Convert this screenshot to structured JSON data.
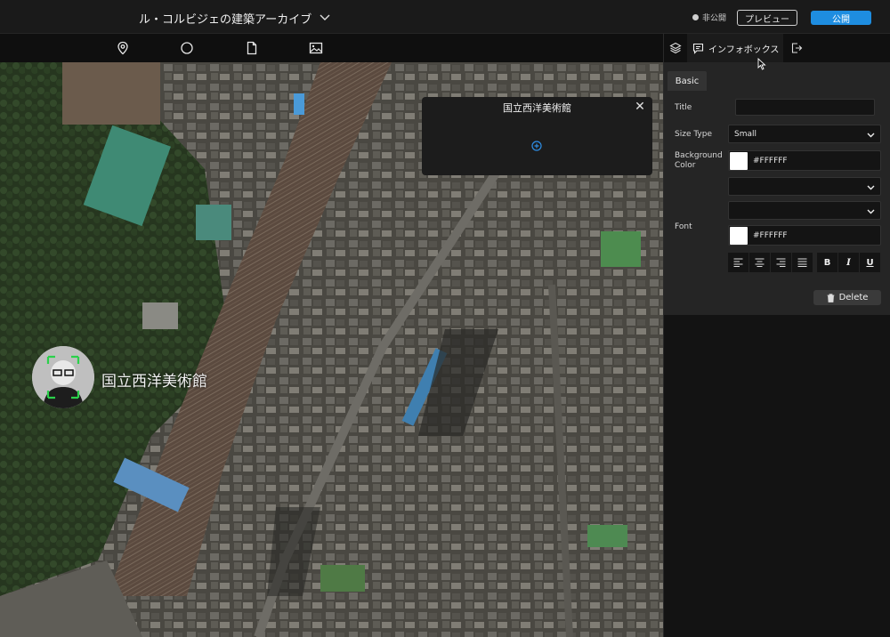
{
  "header": {
    "project_title": "ル・コルビジェの建築アーカイブ",
    "status_label": "非公開",
    "preview_label": "プレビュー",
    "publish_label": "公開",
    "accent_color": "#1e8de0"
  },
  "toolbar": {
    "tools": [
      "map-pin-icon",
      "circle-icon",
      "document-icon",
      "image-icon"
    ]
  },
  "map": {
    "popup": {
      "title": "国立西洋美術館",
      "close_symbol": "✕"
    },
    "marker": {
      "label": "国立西洋美術館"
    }
  },
  "panel": {
    "tabs": {
      "layers_icon": "layers-icon",
      "active_label": "インフォボックス",
      "exit_icon": "exit-icon"
    },
    "basic_tab": "Basic",
    "title_label": "Title",
    "title_value": "",
    "size_type_label": "Size Type",
    "size_type_value": "Small",
    "background_label_1": "Background",
    "background_label_2": "Color",
    "background_value": "#FFFFFF",
    "font_label": "Font",
    "font_color_value": "#FFFFFF",
    "bold": "B",
    "italic": "I",
    "underline": "U",
    "delete_label": "Delete"
  }
}
